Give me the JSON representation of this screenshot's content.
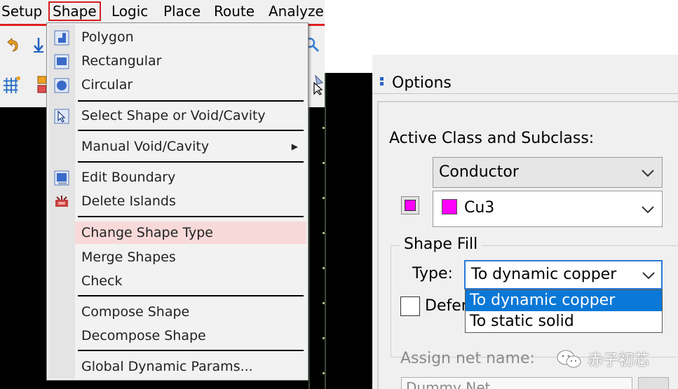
{
  "menubar": {
    "items": [
      {
        "label": "Setup"
      },
      {
        "label": "Shape"
      },
      {
        "label": "Logic"
      },
      {
        "label": "Place"
      },
      {
        "label": "Route"
      },
      {
        "label": "Analyze"
      }
    ]
  },
  "shape_menu": {
    "items": [
      {
        "label": "Polygon",
        "icon": "polygon-icon"
      },
      {
        "label": "Rectangular",
        "icon": "rectangle-icon"
      },
      {
        "label": "Circular",
        "icon": "circle-icon"
      },
      {
        "label": "Select Shape or Void/Cavity",
        "icon": "select-shape-icon"
      },
      {
        "label": "Manual Void/Cavity",
        "submenu": true
      },
      {
        "label": "Edit Boundary",
        "icon": "edit-boundary-icon"
      },
      {
        "label": "Delete Islands",
        "icon": "delete-islands-icon"
      },
      {
        "label": "Change Shape Type",
        "highlighted": true
      },
      {
        "label": "Merge Shapes"
      },
      {
        "label": "Check"
      },
      {
        "label": "Compose Shape"
      },
      {
        "label": "Decompose Shape"
      },
      {
        "label": "Global Dynamic Params..."
      }
    ]
  },
  "options": {
    "title": "Options",
    "active_class_label": "Active Class and Subclass:",
    "class_value": "Conductor",
    "subclass_value": "Cu3",
    "subclass_color": "#ff00ff",
    "shape_fill_label": "Shape Fill",
    "type_label": "Type:",
    "type_value": "To dynamic copper",
    "type_options": [
      "To dynamic copper",
      "To static solid"
    ],
    "defer_label": "Defer",
    "assign_net_label": "Assign net name:",
    "net_value": "Dummy Net"
  },
  "watermark": {
    "text": "赤子初芯"
  },
  "colors": {
    "accent": "#0a78d7",
    "highlight": "#f7d9d9",
    "active_menu_border": "#d42020"
  }
}
